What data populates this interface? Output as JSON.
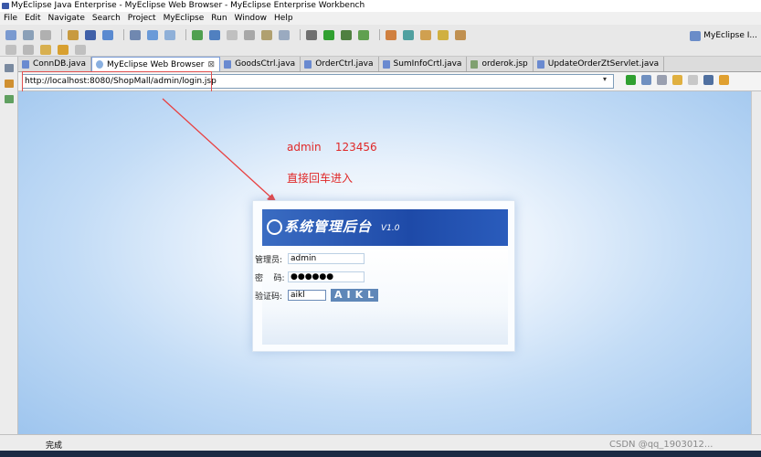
{
  "window": {
    "title": "MyEclipse Java Enterprise - MyEclipse Web Browser - MyEclipse Enterprise Workbench"
  },
  "menu": [
    "File",
    "Edit",
    "Navigate",
    "Search",
    "Project",
    "MyEclipse",
    "Run",
    "Window",
    "Help"
  ],
  "perspective": {
    "label": "MyEclipse I..."
  },
  "tabs": [
    {
      "label": "ConnDB.java"
    },
    {
      "label": "MyEclipse Web Browser",
      "active": true,
      "close": "⊠"
    },
    {
      "label": "GoodsCtrl.java"
    },
    {
      "label": "OrderCtrl.java"
    },
    {
      "label": "SumInfoCrtl.java"
    },
    {
      "label": "orderok.jsp"
    },
    {
      "label": "UpdateOrderZtServlet.java"
    }
  ],
  "browser": {
    "url": "http://localhost:8080/ShopMall/admin/login.jsp",
    "dropdown": "▾"
  },
  "annotations": {
    "credentials": "admin    123456",
    "hint": "直接回车进入"
  },
  "login": {
    "banner_title": "系统管理后台",
    "version": "V1.0",
    "admin_label": "管理员:",
    "admin_value": "admin",
    "password_label": "密    码:",
    "password_value": "●●●●●●",
    "captcha_label": "验证码:",
    "captcha_input": "aikl",
    "captcha_image": "AIKL"
  },
  "status": {
    "text": "完成"
  },
  "watermark": "CSDN @qq_1903012..."
}
